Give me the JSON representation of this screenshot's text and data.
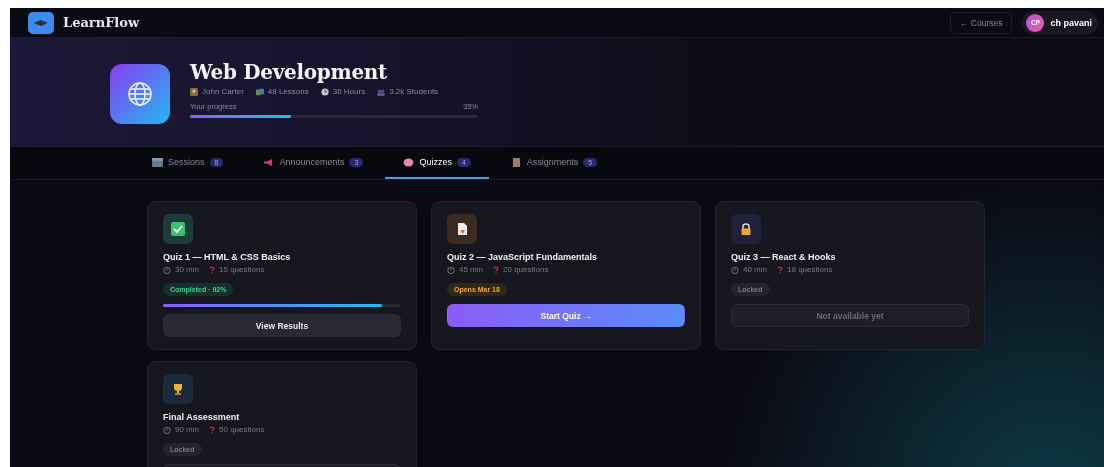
{
  "app": {
    "name": "LearnFlow"
  },
  "header": {
    "back_link": "← Courses",
    "user": {
      "initials": "CP",
      "name": "ch pavani"
    }
  },
  "course": {
    "title": "Web Development",
    "stats": [
      {
        "kind": "instructor",
        "text": "John Carter"
      },
      {
        "kind": "lessons",
        "text": "48 Lessons"
      },
      {
        "kind": "hours",
        "text": "36 Hours"
      },
      {
        "kind": "students",
        "text": "3.2k Students"
      }
    ],
    "progress": {
      "label": "Your progress",
      "reading": "35%",
      "level": 0.35
    }
  },
  "tabs": [
    {
      "kind": "sessions",
      "label": "Sessions",
      "count": "8",
      "selected": false
    },
    {
      "kind": "announcements",
      "label": "Announcements",
      "count": "3",
      "selected": false
    },
    {
      "kind": "quizzes",
      "label": "Quizzes",
      "count": "4",
      "selected": true
    },
    {
      "kind": "assignments",
      "label": "Assignments",
      "count": "5",
      "selected": false
    }
  ],
  "quizzes": [
    {
      "kind": "completed",
      "title": "Quiz 1 — HTML & CSS Basics",
      "duration": "30 min",
      "questions": "15 questions",
      "status": "Completed · 92%",
      "level": 0.92,
      "button": "View Results"
    },
    {
      "kind": "open",
      "title": "Quiz 2 — JavaScript Fundamentals",
      "duration": "45 min",
      "questions": "20 questions",
      "status": "Opens Mar 18",
      "button": "Start Quiz →"
    },
    {
      "kind": "locked",
      "title": "Quiz 3 — React & Hooks",
      "duration": "40 min",
      "questions": "18 questions",
      "status": "Locked",
      "button": "Not available yet"
    },
    {
      "kind": "final",
      "title": "Final Assessment",
      "duration": "90 min",
      "questions": "50 questions",
      "status": "Locked"
    }
  ]
}
